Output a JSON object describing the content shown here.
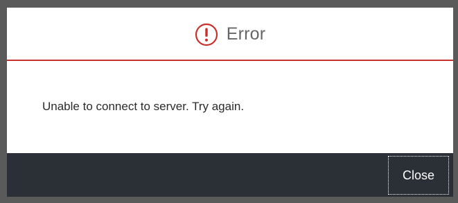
{
  "dialog": {
    "title": "Error",
    "icon": "error-circle-icon",
    "accent_color": "#c8302c",
    "message": "Unable to connect to server. Try again.",
    "close_label": "Close"
  }
}
